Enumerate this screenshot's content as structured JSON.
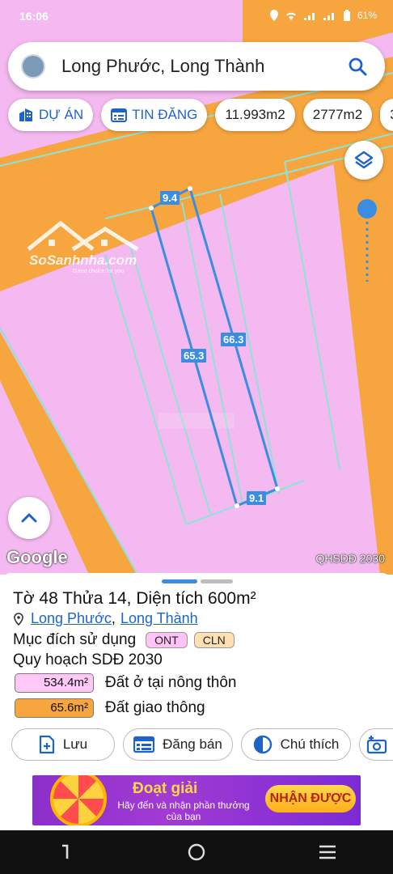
{
  "status_bar": {
    "time": "16:06",
    "battery": "61%"
  },
  "search": {
    "query": "Long Phước, Long Thành"
  },
  "chips": [
    {
      "label": "DỰ ÁN",
      "icon": "building-icon"
    },
    {
      "label": "TIN ĐĂNG",
      "icon": "calendar-list-icon"
    },
    {
      "label": "11.993m2"
    },
    {
      "label": "2777m2"
    },
    {
      "label": "3"
    }
  ],
  "map": {
    "plan_tag": "QHSDĐ 2030",
    "google_logo": "Google",
    "watermark": "SoSanhnha.com",
    "watermark_sub": "Great choice for you",
    "dimensions": {
      "top": "9.4",
      "left": "65.3",
      "right": "66.3",
      "bottom": "9.1"
    },
    "colors": {
      "residential": "#f4b9f0",
      "road": "#f6a53f",
      "boundary": "#3b8de0"
    }
  },
  "sheet": {
    "title": "Tờ 48 Thửa 14, Diện tích 600m²",
    "location_ward": "Long Phước",
    "location_sep": ",",
    "location_district": "Long Thành",
    "purpose_label": "Mục đích sử dụng",
    "purpose_tags": [
      "ONT",
      "CLN"
    ],
    "plan_label": "Quy hoạch SDĐ 2030",
    "areas": [
      {
        "value": "534.4m²",
        "label": "Đất ở tại nông thôn",
        "color": "#ffc8f7"
      },
      {
        "value": "65.6m²",
        "label": "Đất giao thông",
        "color": "#f6a53f"
      }
    ],
    "actions": {
      "save": "Lưu",
      "post": "Đăng bán",
      "legend": "Chú thích"
    }
  },
  "banner": {
    "title": "Đoạt giải",
    "subtitle": "Hãy đến và nhận phần thưởng của bạn",
    "cta": "NHẬN ĐƯỢC"
  }
}
